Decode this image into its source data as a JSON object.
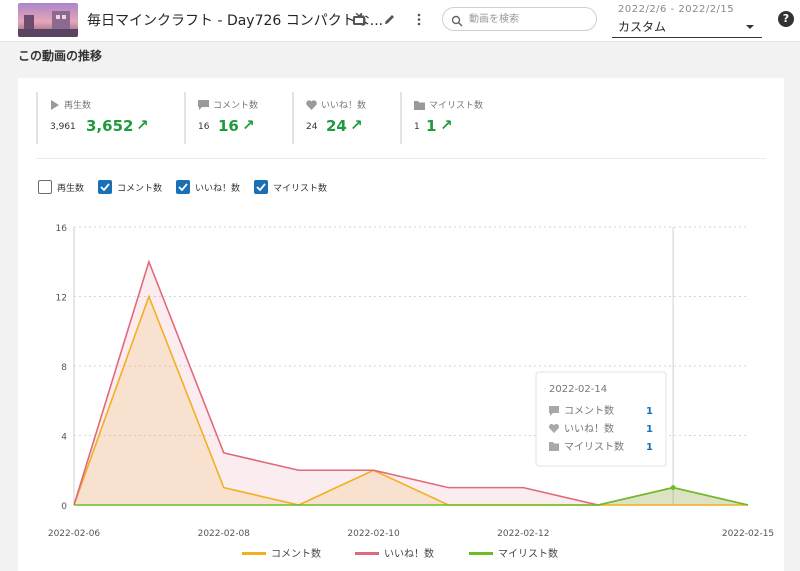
{
  "header": {
    "video_title": "毎日マインクラフト - Day726 コンパクトな...",
    "search_placeholder": "動画を検索",
    "date_range_label": "2022/2/6 - 2022/2/15",
    "range_select_value": "カスタム",
    "help_glyph": "?"
  },
  "section_title": "この動画の推移",
  "stats": [
    {
      "label": "再生数",
      "icon": "play-icon",
      "prev": "3,961",
      "current": "3,652"
    },
    {
      "label": "コメント数",
      "icon": "comment-icon",
      "prev": "16",
      "current": "16"
    },
    {
      "label": "いいね！数",
      "icon": "heart-icon",
      "prev": "24",
      "current": "24"
    },
    {
      "label": "マイリスト数",
      "icon": "folder-icon",
      "prev": "1",
      "current": "1"
    }
  ],
  "series_toggles": [
    {
      "label": "再生数",
      "checked": false
    },
    {
      "label": "コメント数",
      "checked": true
    },
    {
      "label": "いいね！数",
      "checked": true
    },
    {
      "label": "マイリスト数",
      "checked": true
    }
  ],
  "tooltip": {
    "date": "2022-02-14",
    "rows": [
      {
        "label": "コメント数",
        "value": "1",
        "icon": "comment-icon"
      },
      {
        "label": "いいね！数",
        "value": "1",
        "icon": "heart-icon"
      },
      {
        "label": "マイリスト数",
        "value": "1",
        "icon": "folder-icon"
      }
    ]
  },
  "colors": {
    "comment": "#f2b01e",
    "like": "#e06a7b",
    "mylist": "#6abf24",
    "positive": "#1f9a3c",
    "checkbox": "#1a6fb5"
  },
  "chart_data": {
    "type": "area",
    "x": [
      "2022-02-06",
      "2022-02-07",
      "2022-02-08",
      "2022-02-09",
      "2022-02-10",
      "2022-02-11",
      "2022-02-12",
      "2022-02-13",
      "2022-02-14",
      "2022-02-15"
    ],
    "x_tick_labels": [
      "2022-02-06",
      "2022-02-08",
      "2022-02-10",
      "2022-02-12",
      "2022-02-15"
    ],
    "y_ticks": [
      "0",
      "4",
      "8",
      "12",
      "16"
    ],
    "ylim": [
      0,
      16
    ],
    "grid": true,
    "legend_position": "bottom",
    "series": [
      {
        "name": "コメント数",
        "color": "#f2b01e",
        "values": [
          0,
          12,
          1,
          0,
          2,
          0,
          0,
          0,
          0,
          0
        ]
      },
      {
        "name": "いいね！数",
        "color": "#e06a7b",
        "values": [
          0,
          14,
          3,
          2,
          2,
          1,
          1,
          0,
          1,
          0
        ]
      },
      {
        "name": "マイリスト数",
        "color": "#6abf24",
        "values": [
          0,
          0,
          0,
          0,
          0,
          0,
          0,
          0,
          1,
          0
        ]
      }
    ]
  }
}
